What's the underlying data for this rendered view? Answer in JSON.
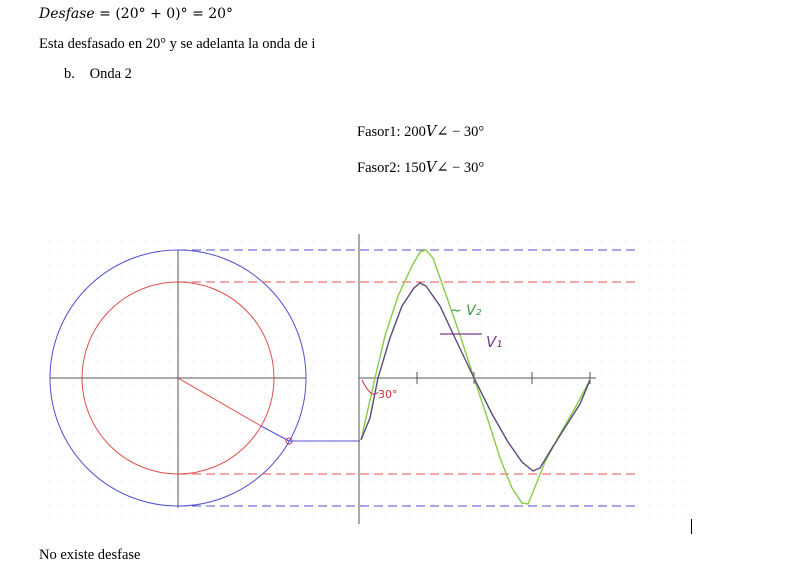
{
  "equation": {
    "lhs": "Desfase",
    "rhs": "= (20° + 0)° = 20°"
  },
  "description": "Esta desfasado en 20° y se adelanta la onda de i",
  "item": {
    "marker": "b.",
    "label": "Onda 2"
  },
  "fasor1": {
    "label": "Fasor1: 200",
    "symbol": "V∠",
    "value": " − 30°"
  },
  "fasor2": {
    "label": "Fasor2: 150",
    "symbol": "V∠",
    "value": " − 30°"
  },
  "diagram": {
    "annotation_v2": "~ V₂",
    "annotation_v1": "V₁",
    "angle_label": "30°",
    "colors": {
      "outer": "#5050d0",
      "inner": "#e05050",
      "v2_wave": "#88cc44",
      "v1_wave": "#5a4a7a",
      "axis": "#555555",
      "handwriting_green": "#3a9a3a",
      "handwriting_purple": "#7a3a8a",
      "angle": "#cc3333"
    }
  },
  "conclusion": "No existe desfase"
}
